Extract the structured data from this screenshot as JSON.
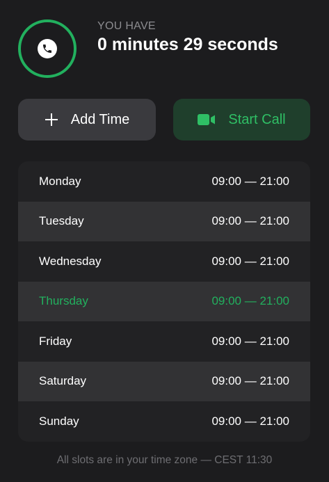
{
  "header": {
    "label": "YOU HAVE",
    "remaining": "0 minutes 29 seconds",
    "icon": "phone-icon",
    "accent_color": "#22b05e"
  },
  "actions": {
    "add_time": {
      "label": "Add Time",
      "icon": "plus-icon"
    },
    "start_call": {
      "label": "Start Call",
      "icon": "video-camera-icon",
      "color": "#2fbf65"
    }
  },
  "schedule": {
    "days": [
      {
        "day": "Monday",
        "hours": "09:00 — 21:00"
      },
      {
        "day": "Tuesday",
        "hours": "09:00 — 21:00"
      },
      {
        "day": "Wednesday",
        "hours": "09:00 — 21:00"
      },
      {
        "day": "Thursday",
        "hours": "09:00 — 21:00",
        "current": true
      },
      {
        "day": "Friday",
        "hours": "09:00 — 21:00"
      },
      {
        "day": "Saturday",
        "hours": "09:00 — 21:00"
      },
      {
        "day": "Sunday",
        "hours": "09:00 — 21:00"
      }
    ]
  },
  "footer": {
    "note": "All slots are in your time zone — CEST 11:30"
  }
}
